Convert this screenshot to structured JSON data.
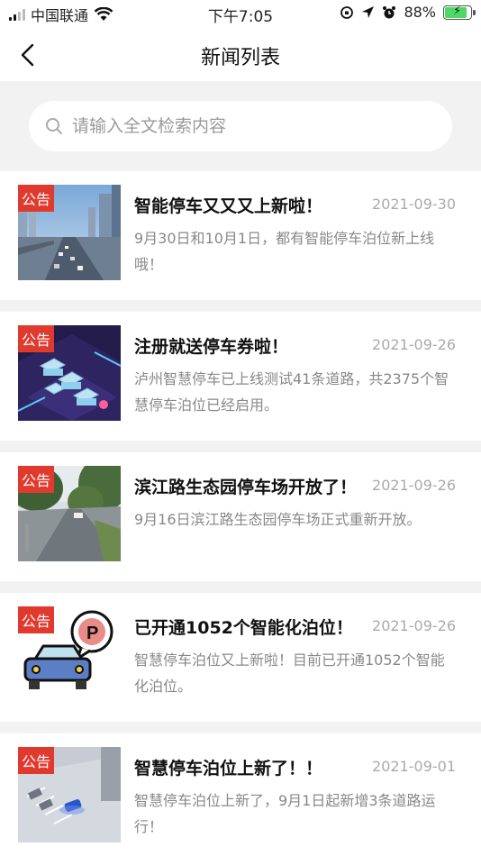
{
  "status": {
    "carrier": "中国联通",
    "time": "下午7:05",
    "battery": "88%",
    "battery_level": 0.88
  },
  "nav": {
    "title": "新闻列表"
  },
  "search": {
    "placeholder": "请输入全文检索内容"
  },
  "colors": {
    "tag": "#e03a2f",
    "accent": "#e03a2f"
  },
  "news": [
    {
      "tag": "公告",
      "title": "智能停车又又又上新啦！",
      "date": "2021-09-30",
      "summary": "9月30日和10月1日，都有智能停车泊位新上线哦！",
      "image": "city-road-photo"
    },
    {
      "tag": "公告",
      "title": "注册就送停车券啦！",
      "date": "2021-09-26",
      "summary": "泸州智慧停车已上线测试41条道路，共2375个智慧停车泊位已经启用。",
      "image": "isometric-cars-illustration"
    },
    {
      "tag": "公告",
      "title": "滨江路生态园停车场开放了！",
      "date": "2021-09-26",
      "summary": "9月16日滨江路生态园停车场正式重新开放。",
      "image": "park-road-photo"
    },
    {
      "tag": "公告",
      "title": "已开通1052个智能化泊位！",
      "date": "2021-09-26",
      "summary": "智慧停车泊位又上新啦！目前已开通1052个智能化泊位。",
      "image": "car-parking-sign-icon"
    },
    {
      "tag": "公告",
      "title": "智慧停车泊位上新了！！",
      "date": "2021-09-01",
      "summary": "智慧停车泊位上新了，9月1日起新增3条道路运行！",
      "image": "parking-lot-render"
    }
  ]
}
